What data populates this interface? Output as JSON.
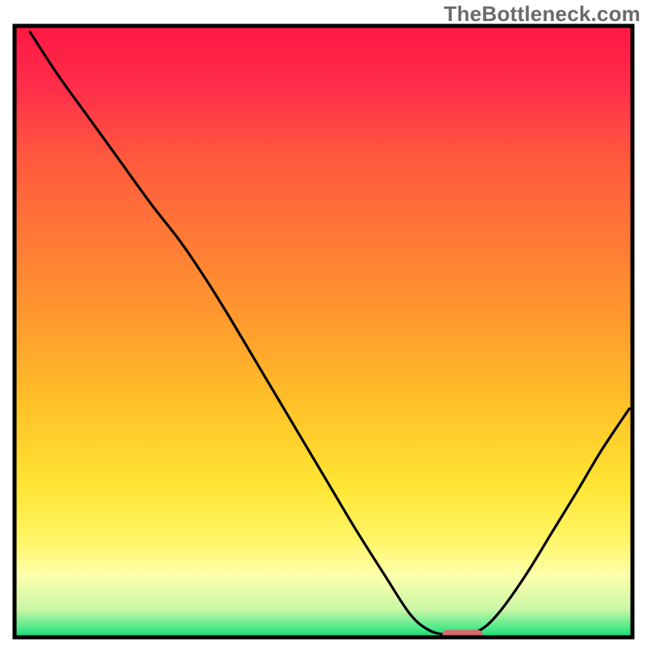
{
  "watermark": "TheBottleneck.com",
  "chart_data": {
    "type": "line",
    "title": "",
    "xlabel": "",
    "ylabel": "",
    "xlim": [
      0,
      100
    ],
    "ylim": [
      0,
      100
    ],
    "grid": false,
    "background": {
      "type": "vertical-gradient",
      "stops": [
        {
          "offset": 0.0,
          "color": "#ff1744"
        },
        {
          "offset": 0.1,
          "color": "#ff2e4a"
        },
        {
          "offset": 0.22,
          "color": "#ff5a3d"
        },
        {
          "offset": 0.35,
          "color": "#ff7a36"
        },
        {
          "offset": 0.48,
          "color": "#ff9a2e"
        },
        {
          "offset": 0.62,
          "color": "#ffc128"
        },
        {
          "offset": 0.75,
          "color": "#ffe533"
        },
        {
          "offset": 0.84,
          "color": "#fff566"
        },
        {
          "offset": 0.9,
          "color": "#fdffad"
        },
        {
          "offset": 0.955,
          "color": "#c9f7a6"
        },
        {
          "offset": 0.985,
          "color": "#4de88a"
        },
        {
          "offset": 1.0,
          "color": "#17d874"
        }
      ]
    },
    "series": [
      {
        "name": "curve",
        "color": "#000000",
        "x": [
          2.5,
          7,
          12,
          17,
          22,
          27,
          31,
          35,
          40,
          45,
          50,
          55,
          60,
          64,
          67,
          70,
          73,
          76,
          79,
          83,
          87,
          91,
          95,
          99.5
        ],
        "y": [
          99,
          92,
          85,
          78,
          71,
          64.5,
          58.5,
          52,
          43.5,
          35,
          26.5,
          18,
          10,
          3.8,
          1.2,
          0.4,
          0.4,
          1.6,
          4.8,
          10.6,
          17.2,
          23.8,
          30.6,
          37.4
        ]
      }
    ],
    "marker": {
      "name": "marker-bar",
      "shape": "rounded-rect",
      "color": "#d46a6a",
      "x_center": 72.5,
      "y_center": 0.4,
      "width": 6.5,
      "height": 1.6,
      "rx": 0.8
    },
    "frame": {
      "stroke": "#000000",
      "stroke_width": 5
    },
    "annotations": []
  }
}
